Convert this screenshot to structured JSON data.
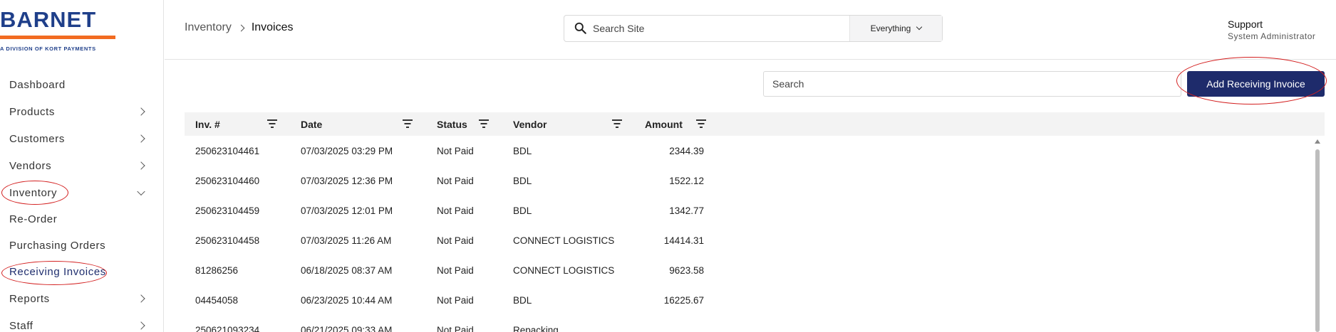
{
  "brand": {
    "name": "BARNET",
    "tagline": "A DIVISION OF KORT PAYMENTS",
    "primary_color": "#1f3f8a",
    "accent_color": "#f26b21"
  },
  "sidebar": {
    "items": [
      {
        "label": "Dashboard",
        "chevron": "none"
      },
      {
        "label": "Products",
        "chevron": "right"
      },
      {
        "label": "Customers",
        "chevron": "right"
      },
      {
        "label": "Vendors",
        "chevron": "right"
      },
      {
        "label": "Inventory",
        "chevron": "down"
      },
      {
        "label": "Re-Order",
        "chevron": "none"
      },
      {
        "label": "Purchasing Orders",
        "chevron": "none"
      },
      {
        "label": "Receiving Invoices",
        "chevron": "none",
        "active": true
      },
      {
        "label": "Reports",
        "chevron": "right"
      },
      {
        "label": "Staff",
        "chevron": "right"
      }
    ]
  },
  "header": {
    "breadcrumb": {
      "parent": "Inventory",
      "current": "Invoices"
    },
    "search": {
      "placeholder": "Search Site",
      "scope": "Everything"
    },
    "user": {
      "name": "Support",
      "role": "System Administrator"
    }
  },
  "toolbar": {
    "search_placeholder": "Search",
    "add_button": "Add Receiving Invoice",
    "button_color": "#1e2b6b"
  },
  "table": {
    "columns": [
      "Inv. #",
      "Date",
      "Status",
      "Vendor",
      "Amount"
    ],
    "rows": [
      {
        "inv": "250623104461",
        "date": "07/03/2025 03:29 PM",
        "status": "Not Paid",
        "vendor": "BDL",
        "amount": "2344.39"
      },
      {
        "inv": "250623104460",
        "date": "07/03/2025 12:36 PM",
        "status": "Not Paid",
        "vendor": "BDL",
        "amount": "1522.12"
      },
      {
        "inv": "250623104459",
        "date": "07/03/2025 12:01 PM",
        "status": "Not Paid",
        "vendor": "BDL",
        "amount": "1342.77"
      },
      {
        "inv": "250623104458",
        "date": "07/03/2025 11:26 AM",
        "status": "Not Paid",
        "vendor": "CONNECT LOGISTICS",
        "amount": "14414.31"
      },
      {
        "inv": "81286256",
        "date": "06/18/2025 08:37 AM",
        "status": "Not Paid",
        "vendor": "CONNECT LOGISTICS",
        "amount": "9623.58"
      },
      {
        "inv": "04454058",
        "date": "06/23/2025 10:44 AM",
        "status": "Not Paid",
        "vendor": "BDL",
        "amount": "16225.67"
      },
      {
        "inv": "250621093234",
        "date": "06/21/2025 09:33 AM",
        "status": "Not Paid",
        "vendor": "Repacking",
        "amount": ""
      }
    ]
  },
  "annotations": {
    "highlight_color": "#d31f1f"
  }
}
